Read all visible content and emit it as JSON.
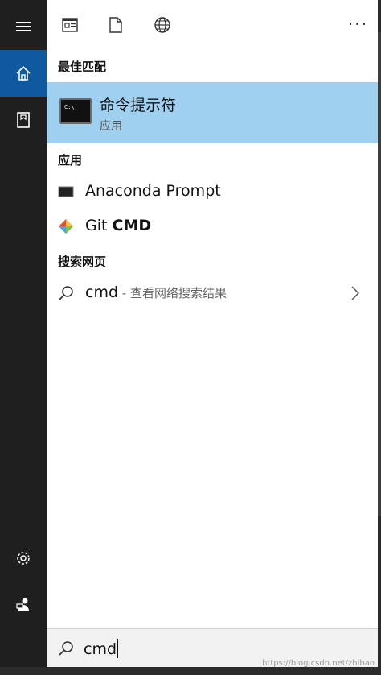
{
  "toolbar": {
    "more_label": "···"
  },
  "rail": {
    "items": [
      {
        "icon": "hamburger-menu-icon"
      },
      {
        "icon": "home-icon"
      },
      {
        "icon": "document-book-icon"
      },
      {
        "icon": "settings-gear-icon"
      },
      {
        "icon": "user-icon"
      }
    ]
  },
  "sections": {
    "best_match": "最佳匹配",
    "apps": "应用",
    "web": "搜索网页"
  },
  "best_match": {
    "name": "命令提示符",
    "subtitle": "应用"
  },
  "apps": [
    {
      "label": "Anaconda Prompt",
      "icon": "anaconda-prompt-icon"
    },
    {
      "label_prefix": "Git ",
      "label_bold": "CMD",
      "icon": "git-icon"
    }
  ],
  "web_result": {
    "query": "cmd",
    "suffix": " - 查看网络搜索结果"
  },
  "search": {
    "value": "cmd"
  },
  "watermark": "https://blog.csdn.net/zhibao"
}
